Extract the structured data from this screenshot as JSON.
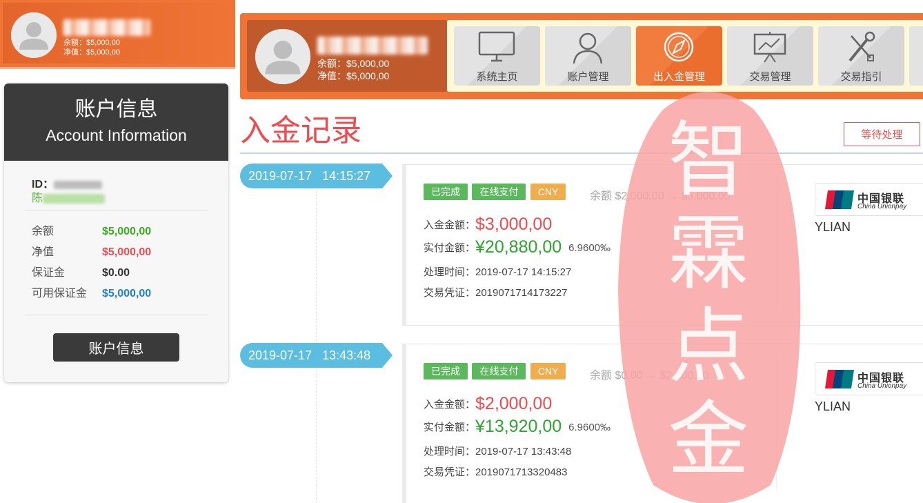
{
  "mini_header": {
    "balance_text": "余额：$5,000,00",
    "equity_text": "净值：$5,000,00"
  },
  "account_card": {
    "title_cn": "账户信息",
    "title_en": "Account Information",
    "id_label": "ID：",
    "name_prefix": "陈",
    "stats": [
      {
        "label": "余额",
        "value": "$5,000,00",
        "color": "#3aab1f"
      },
      {
        "label": "净值",
        "value": "$5,000,00",
        "color": "#ee4c50"
      },
      {
        "label": "保证金",
        "value": "$0.00",
        "color": "#333333"
      },
      {
        "label": "可用保证金",
        "value": "$5,000,00",
        "color": "#1e7fd8"
      }
    ],
    "button_label": "账户信息"
  },
  "topbar": {
    "balance_text": "余额：$5,000,00",
    "equity_text": "净值：$5,000,00",
    "nav": [
      {
        "label": "系统主页",
        "icon": "monitor-icon",
        "active": false
      },
      {
        "label": "账户管理",
        "icon": "user-icon",
        "active": false
      },
      {
        "label": "出入金管理",
        "icon": "compass-icon",
        "active": true
      },
      {
        "label": "交易管理",
        "icon": "chart-board-icon",
        "active": false
      },
      {
        "label": "交易指引",
        "icon": "tools-icon",
        "active": false
      }
    ]
  },
  "page": {
    "title": "入金记录",
    "status_button": "等待处理"
  },
  "records": [
    {
      "timestamp": "2019-07-17   14:15:27",
      "badges": [
        "已完成",
        "在线支付",
        "CNY"
      ],
      "balance_change": "余额 $2,000,00 → $5,000,00",
      "deposit_label": "入金金额：",
      "deposit_amount": "$3,000,00",
      "paid_label": "实付金额：",
      "paid_amount": "¥20,880,00",
      "rate": "6.9600‰",
      "process_time": "处理时间：2019-07-17 14:15:27",
      "voucher": "交易凭证：2019071714173227",
      "bank_cn": "中国银联",
      "bank_en": "China Unionpay",
      "channel": "YLIAN"
    },
    {
      "timestamp": "2019-07-17   13:43:48",
      "badges": [
        "已完成",
        "在线支付",
        "CNY"
      ],
      "balance_change": "余额 $0.00 → $2,000,00",
      "deposit_label": "入金金额：",
      "deposit_amount": "$2,000,00",
      "paid_label": "实付金额：",
      "paid_amount": "¥13,920,00",
      "rate": "6.9600‰",
      "process_time": "处理时间：2019-07-17 13:43:48",
      "voucher": "交易凭证：2019071713320483",
      "bank_cn": "中国银联",
      "bank_en": "China Unionpay",
      "channel": "YLIAN"
    }
  ],
  "watermark": {
    "chars": [
      "智",
      "霖",
      "点",
      "金"
    ],
    "color": "#f8a3a3"
  }
}
